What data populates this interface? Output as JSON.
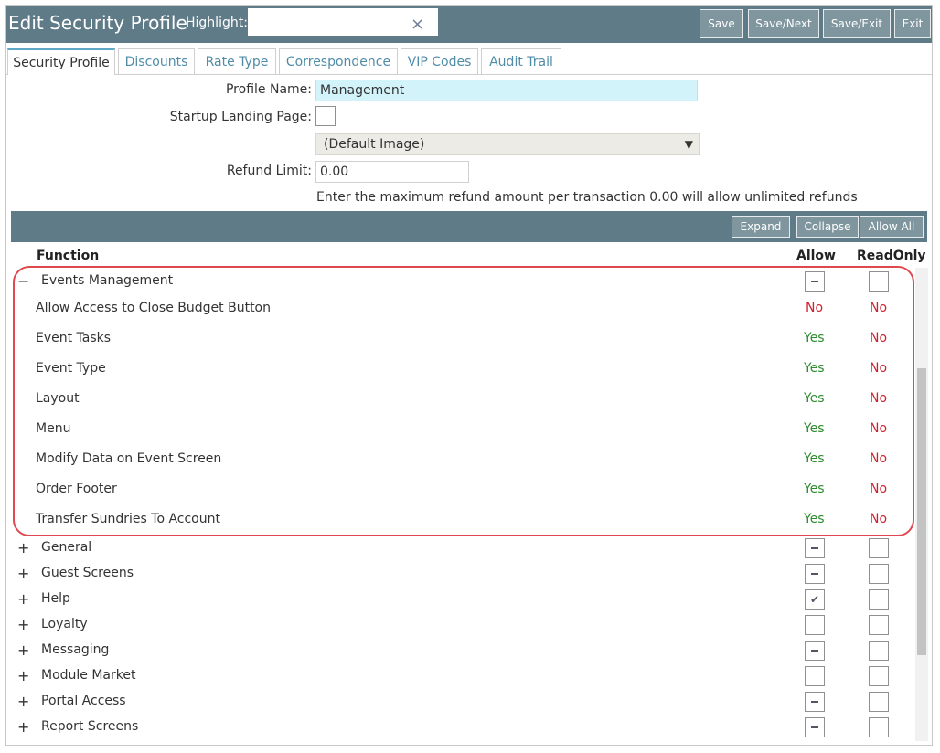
{
  "header": {
    "title": "Edit Security Profile",
    "highlight_label": "Highlight:",
    "highlight_value": "",
    "clear_glyph": "×",
    "buttons": [
      "Save",
      "Save/Next",
      "Save/Exit",
      "Exit"
    ]
  },
  "tabs": [
    "Security Profile",
    "Discounts",
    "Rate Type",
    "Correspondence",
    "VIP Codes",
    "Audit Trail"
  ],
  "active_tab": "Security Profile",
  "form": {
    "profile_name_label": "Profile Name:",
    "profile_name_value": "Management",
    "startup_label": "Startup Landing Page:",
    "image_select": "(Default Image)",
    "refund_label": "Refund Limit:",
    "refund_value": "0.00",
    "refund_hint": "Enter the maximum refund amount per transaction 0.00 will allow unlimited refunds"
  },
  "grid": {
    "buttons": [
      "Expand",
      "Collapse",
      "Allow All"
    ],
    "headers": {
      "function": "Function",
      "allow": "Allow",
      "readonly": "ReadOnly"
    },
    "expanded_group": {
      "name": "Events Management",
      "sign": "−",
      "items": [
        {
          "name": "Allow Access to Close Budget Button",
          "allow": "No",
          "readonly": "No"
        },
        {
          "name": "Event Tasks",
          "allow": "Yes",
          "readonly": "No"
        },
        {
          "name": "Event Type",
          "allow": "Yes",
          "readonly": "No"
        },
        {
          "name": "Layout",
          "allow": "Yes",
          "readonly": "No"
        },
        {
          "name": "Menu",
          "allow": "Yes",
          "readonly": "No"
        },
        {
          "name": "Modify Data on Event Screen",
          "allow": "Yes",
          "readonly": "No"
        },
        {
          "name": "Order Footer",
          "allow": "Yes",
          "readonly": "No"
        },
        {
          "name": "Transfer Sundries To Account",
          "allow": "Yes",
          "readonly": "No"
        }
      ]
    },
    "collapsed_groups": [
      {
        "name": "General",
        "sign": "+",
        "allow_state": "partial"
      },
      {
        "name": "Guest Screens",
        "sign": "+",
        "allow_state": "partial"
      },
      {
        "name": "Help",
        "sign": "+",
        "allow_state": "checked"
      },
      {
        "name": "Loyalty",
        "sign": "+",
        "allow_state": "empty"
      },
      {
        "name": "Messaging",
        "sign": "+",
        "allow_state": "partial"
      },
      {
        "name": "Module Market",
        "sign": "+",
        "allow_state": "empty"
      },
      {
        "name": "Portal Access",
        "sign": "+",
        "allow_state": "partial"
      },
      {
        "name": "Report Screens",
        "sign": "+",
        "allow_state": "partial"
      }
    ],
    "check_glyph": "✔"
  },
  "colors": {
    "accent_bar": "#5f7b87",
    "yes": "#2e8b2e",
    "no": "#d0202e",
    "highlight_outline": "#e0484f"
  }
}
